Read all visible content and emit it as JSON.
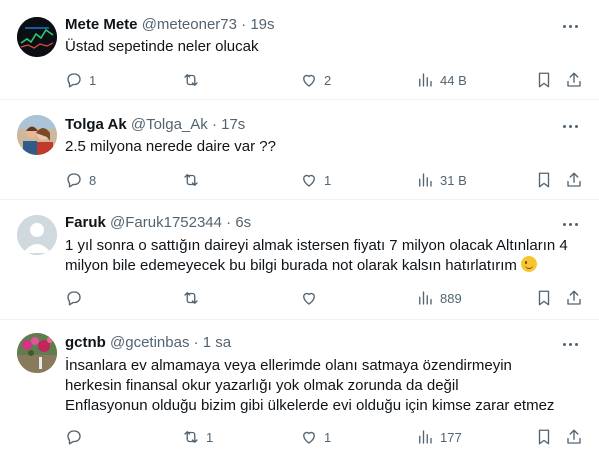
{
  "tweets": [
    {
      "name": "Mete Mete",
      "handle": "@meteoner73",
      "sep": "·",
      "time": "19s",
      "lines": [
        "Üstad sepetinde neler olucak"
      ],
      "replies": "1",
      "retweets": "",
      "likes": "2",
      "views": "44 B",
      "avatar_icon": "dark-chart-avatar"
    },
    {
      "name": "Tolga Ak",
      "handle": "@Tolga_Ak",
      "sep": "·",
      "time": "17s",
      "lines": [
        "2.5 milyona nerede daire var ??"
      ],
      "replies": "8",
      "retweets": "",
      "likes": "1",
      "views": "31 B",
      "avatar_icon": "couple-photo-avatar"
    },
    {
      "name": "Faruk",
      "handle": "@Faruk1752344",
      "sep": "·",
      "time": "6s",
      "lines": [
        "1 yıl sonra o sattığın daireyi almak istersen fiyatı 7 milyon olacak Altınların 4",
        "milyon bile edemeyecek bu bilgi burada not olarak kalsın hatırlatırım"
      ],
      "replies": "",
      "retweets": "",
      "likes": "",
      "views": "889",
      "avatar_icon": "default-profile-avatar"
    },
    {
      "name": "gctnb",
      "handle": "@gcetinbas",
      "sep": "·",
      "time": "1 sa",
      "lines": [
        "İnsanlara ev almamaya veya ellerimde olanı satmaya özendirmeyin",
        "herkesin finansal okur yazarlığı yok olmak zorunda da değil",
        "Enflasyonun olduğu bizim gibi ülkelerde evi olduğu için kimse zarar etmez"
      ],
      "replies": "",
      "retweets": "1",
      "likes": "1",
      "views": "177",
      "avatar_icon": "flowers-photo-avatar"
    }
  ],
  "icons": {
    "reply": "reply-icon",
    "retweet": "retweet-icon",
    "like": "like-icon",
    "views": "views-icon",
    "bookmark": "bookmark-icon",
    "share": "share-icon",
    "more": "more-icon"
  },
  "colors": {
    "text": "#0f1419",
    "secondary": "#536471",
    "divider": "#eff3f4"
  }
}
